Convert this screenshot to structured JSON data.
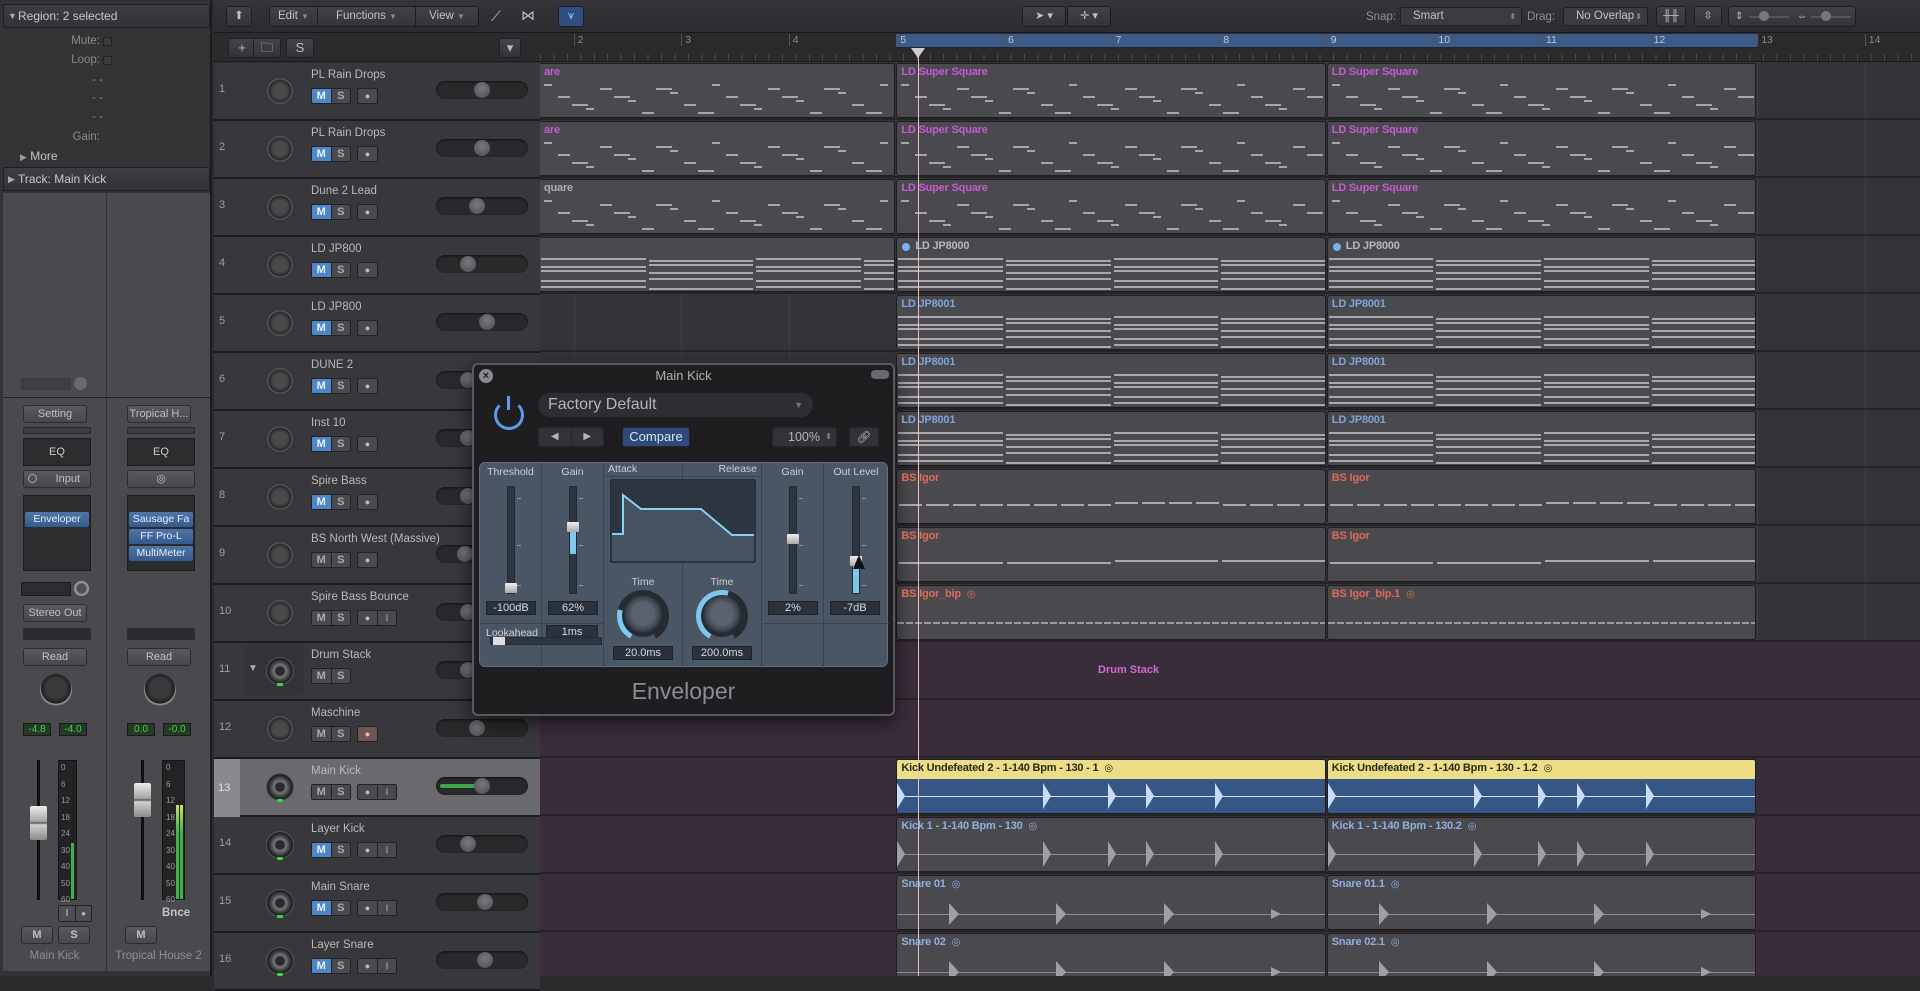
{
  "inspector": {
    "region_header": "Region: 2 selected",
    "mute_label": "Mute:",
    "loop_label": "Loop:",
    "dash_rows": [
      "- -",
      "- -",
      "- -"
    ],
    "gain_label": "Gain:",
    "more_label": "More",
    "track_header": "Track:  Main Kick",
    "strips": [
      {
        "setting_label": "Setting",
        "eq_label": "EQ",
        "input_label": "Input",
        "plugins": [
          "Enveloper"
        ],
        "output_label": "Stereo Out",
        "automation_label": "Read",
        "volume_value": "-4.8",
        "peak_value": "-4.0",
        "mute_label": "M",
        "solo_label": "S",
        "input_monitor_label": "I",
        "name": "Main Kick",
        "meter_scale": [
          "0",
          "6",
          "12",
          "18",
          "24",
          "30",
          "40",
          "50",
          "60"
        ]
      },
      {
        "setting_label": "Tropical H...",
        "eq_label": "EQ",
        "input_icon": "stereo-link-icon",
        "plugins": [
          "Sausage Fa",
          "FF Pro-L",
          "MultiMeter"
        ],
        "automation_label": "Read",
        "volume_value": "0.0",
        "peak_value": "-0.0",
        "mute_label": "M",
        "bounce_label": "Bnce",
        "name": "Tropical House 2",
        "meter_scale": [
          "0",
          "6",
          "12",
          "18",
          "24",
          "30",
          "40",
          "50",
          "60"
        ]
      }
    ]
  },
  "toolbar": {
    "edit_menu": "Edit",
    "functions_menu": "Functions",
    "view_menu": "View",
    "snap_label": "Snap:",
    "snap_value": "Smart",
    "drag_label": "Drag:",
    "drag_value": "No Overlap",
    "add_track_icon": "+",
    "global_tracks_icon": "S"
  },
  "ruler": {
    "bars": [
      "2",
      "3",
      "4",
      "5",
      "6",
      "7",
      "8",
      "9",
      "10",
      "11",
      "12",
      "13",
      "14"
    ],
    "cycle_start_bar": 5,
    "cycle_end_bar": 13,
    "playhead_bar": 5.2
  },
  "tracks": [
    {
      "num": "1",
      "name": "PL Rain Drops",
      "type": "midi",
      "mute": true,
      "pan": 0.5,
      "regions": [
        {
          "label": "are",
          "color": "#c65ad6",
          "kind": "midi"
        },
        {
          "label": "LD Super Square",
          "color": "#c65ad6",
          "kind": "midi"
        },
        {
          "label": "LD Super Square",
          "color": "#c65ad6",
          "kind": "midi"
        }
      ]
    },
    {
      "num": "2",
      "name": "PL Rain Drops",
      "type": "midi",
      "mute": true,
      "pan": 0.5,
      "regions": [
        {
          "label": "are",
          "color": "#c65ad6",
          "kind": "midi"
        },
        {
          "label": "LD Super Square",
          "color": "#c65ad6",
          "kind": "midi"
        },
        {
          "label": "LD Super Square",
          "color": "#c65ad6",
          "kind": "midi"
        }
      ]
    },
    {
      "num": "3",
      "name": "Dune 2 Lead",
      "type": "midi",
      "mute": true,
      "pan": 0.43,
      "regions": [
        {
          "label": "quare",
          "color": "#b0b0b0",
          "kind": "midi"
        },
        {
          "label": "LD Super Square",
          "color": "#c65ad6",
          "kind": "midi"
        },
        {
          "label": "LD Super Square",
          "color": "#c65ad6",
          "kind": "midi"
        }
      ]
    },
    {
      "num": "4",
      "name": "LD JP800",
      "type": "midi",
      "mute": true,
      "pan": 0.3,
      "regions": [
        {
          "label": "",
          "color": "#b0b0b0",
          "kind": "chords"
        },
        {
          "label": "LD JP8000",
          "color": "#b8b8b8",
          "kind": "chords",
          "dot": true
        },
        {
          "label": "LD JP8000",
          "color": "#b8b8b8",
          "kind": "chords",
          "dot": true
        }
      ]
    },
    {
      "num": "5",
      "name": "LD JP800",
      "type": "midi",
      "mute": true,
      "pan": 0.58,
      "regions": [
        null,
        {
          "label": "LD JP8001",
          "color": "#7fa4d8",
          "kind": "chords"
        },
        {
          "label": "LD JP8001",
          "color": "#7fa4d8",
          "kind": "chords"
        }
      ]
    },
    {
      "num": "6",
      "name": "DUNE 2",
      "type": "midi",
      "mute": true,
      "pan": 0.3,
      "regions": [
        null,
        {
          "label": "LD JP8001",
          "color": "#7fa4d8",
          "kind": "chords"
        },
        {
          "label": "LD JP8001",
          "color": "#7fa4d8",
          "kind": "chords"
        }
      ]
    },
    {
      "num": "7",
      "name": "Inst 10",
      "type": "midi",
      "mute": true,
      "pan": 0.3,
      "regions": [
        null,
        {
          "label": "LD JP8001",
          "color": "#7fa4d8",
          "kind": "chords"
        },
        {
          "label": "LD JP8001",
          "color": "#7fa4d8",
          "kind": "chords"
        }
      ]
    },
    {
      "num": "8",
      "name": "Spire Bass",
      "type": "midi",
      "mute": true,
      "pan": 0.3,
      "regions": [
        null,
        {
          "label": "BS Igor",
          "color": "#e06a5a",
          "kind": "bass"
        },
        {
          "label": "BS Igor",
          "color": "#e06a5a",
          "kind": "bass"
        }
      ]
    },
    {
      "num": "9",
      "name": "BS North West (Massive)",
      "type": "midi",
      "mute": false,
      "pan": 0.25,
      "regions": [
        null,
        {
          "label": "BS Igor",
          "color": "#e06a5a",
          "kind": "bass2"
        },
        {
          "label": "BS Igor",
          "color": "#e06a5a",
          "kind": "bass2"
        }
      ]
    },
    {
      "num": "10",
      "name": "Spire Bass Bounce",
      "type": "audio-midi",
      "mute": false,
      "input_monitor": true,
      "pan": 0.3,
      "regions": [
        null,
        {
          "label": "BS Igor_bip",
          "color": "#e06a5a",
          "kind": "audio-flat",
          "loop": true
        },
        {
          "label": "BS Igor_bip.1",
          "color": "#e06a5a",
          "kind": "audio-flat",
          "loop": true
        }
      ]
    },
    {
      "num": "11",
      "name": "Drum Stack",
      "type": "stack",
      "mute": false,
      "folded": false,
      "pan": 0.3,
      "stack_label": "Drum Stack"
    },
    {
      "num": "12",
      "name": "Maschine",
      "type": "midi",
      "mute": false,
      "record_armed": true,
      "pan": 0.42,
      "regions": []
    },
    {
      "num": "13",
      "name": "Main Kick",
      "type": "audio",
      "mute": false,
      "selected": true,
      "input_monitor": true,
      "pan": 0.5,
      "pan_fill": 0.5,
      "regions": [
        null,
        {
          "label": "Kick Undefeated 2 - 1-140 Bpm - 130 - 1",
          "color": "#2a2a1a",
          "kind": "kick",
          "loop": true
        },
        {
          "label": "Kick Undefeated 2 - 1-140 Bpm - 130 - 1.2",
          "color": "#2a2a1a",
          "kind": "kick",
          "loop": true
        }
      ]
    },
    {
      "num": "14",
      "name": "Layer Kick",
      "type": "audio",
      "mute": true,
      "input_monitor": true,
      "pan": 0.3,
      "regions": [
        null,
        {
          "label": "Kick 1 - 1-140 Bpm - 130",
          "color": "#8fb0e0",
          "kind": "audio-hits",
          "loop": true
        },
        {
          "label": "Kick 1 - 1-140 Bpm - 130.2",
          "color": "#8fb0e0",
          "kind": "audio-hits",
          "loop": true
        }
      ]
    },
    {
      "num": "15",
      "name": "Main Snare",
      "type": "audio",
      "mute": true,
      "input_monitor": true,
      "pan": 0.55,
      "regions": [
        null,
        {
          "label": "Snare 01",
          "color": "#8fb0e0",
          "kind": "snare",
          "loop": true
        },
        {
          "label": "Snare 01.1",
          "color": "#8fb0e0",
          "kind": "snare",
          "loop": true
        }
      ]
    },
    {
      "num": "16",
      "name": "Layer Snare",
      "type": "audio",
      "mute": true,
      "input_monitor": true,
      "pan": 0.55,
      "regions": [
        null,
        {
          "label": "Snare 02",
          "color": "#8fb0e0",
          "kind": "snare",
          "loop": true
        },
        {
          "label": "Snare 02.1",
          "color": "#8fb0e0",
          "kind": "snare",
          "loop": true
        }
      ]
    }
  ],
  "plugin_window": {
    "title": "Main Kick",
    "preset": "Factory Default",
    "compare_label": "Compare",
    "zoom_value": "100%",
    "plugin_name": "Enveloper",
    "sections": {
      "threshold": {
        "label": "Threshold",
        "value": "-100dB",
        "level": 0.02
      },
      "attack_gain": {
        "label": "Gain",
        "value": "62%",
        "level": 0.62
      },
      "attack": {
        "label": "Attack",
        "time_label": "Time",
        "value": "20.0ms",
        "amount": 0.25
      },
      "release": {
        "label": "Release",
        "time_label": "Time",
        "value": "200.0ms",
        "amount": 0.55
      },
      "release_gain": {
        "label": "Gain",
        "value": "2%",
        "level": 0.51
      },
      "out_level": {
        "label": "Out Level",
        "value": "-7dB",
        "level": 0.3
      },
      "lookahead": {
        "label": "Lookahead",
        "value": "1ms",
        "amount": 0.05
      }
    }
  }
}
